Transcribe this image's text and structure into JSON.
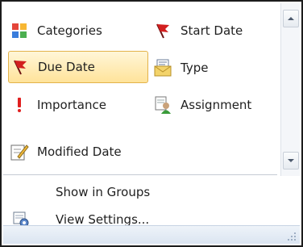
{
  "arrange_items": [
    {
      "label": "Categories",
      "icon": "categories-icon"
    },
    {
      "label": "Start Date",
      "icon": "start-date-flag-icon"
    },
    {
      "label": "Due Date",
      "icon": "due-date-flag-icon",
      "selected": true
    },
    {
      "label": "Type",
      "icon": "type-envelope-icon"
    },
    {
      "label": "Importance",
      "icon": "importance-exclamation-icon"
    },
    {
      "label": "Assignment",
      "icon": "assignment-icon"
    },
    {
      "label": "Modified Date",
      "icon": "modified-date-icon"
    }
  ],
  "menu_items": {
    "show_in_groups": "Show in Groups",
    "view_settings": "View Settings..."
  },
  "colors": {
    "selected_fill": "#ffe39a",
    "selected_border": "#e3b24a",
    "flag_red": "#d21f1f",
    "status_bar": "#dbe5f1"
  }
}
